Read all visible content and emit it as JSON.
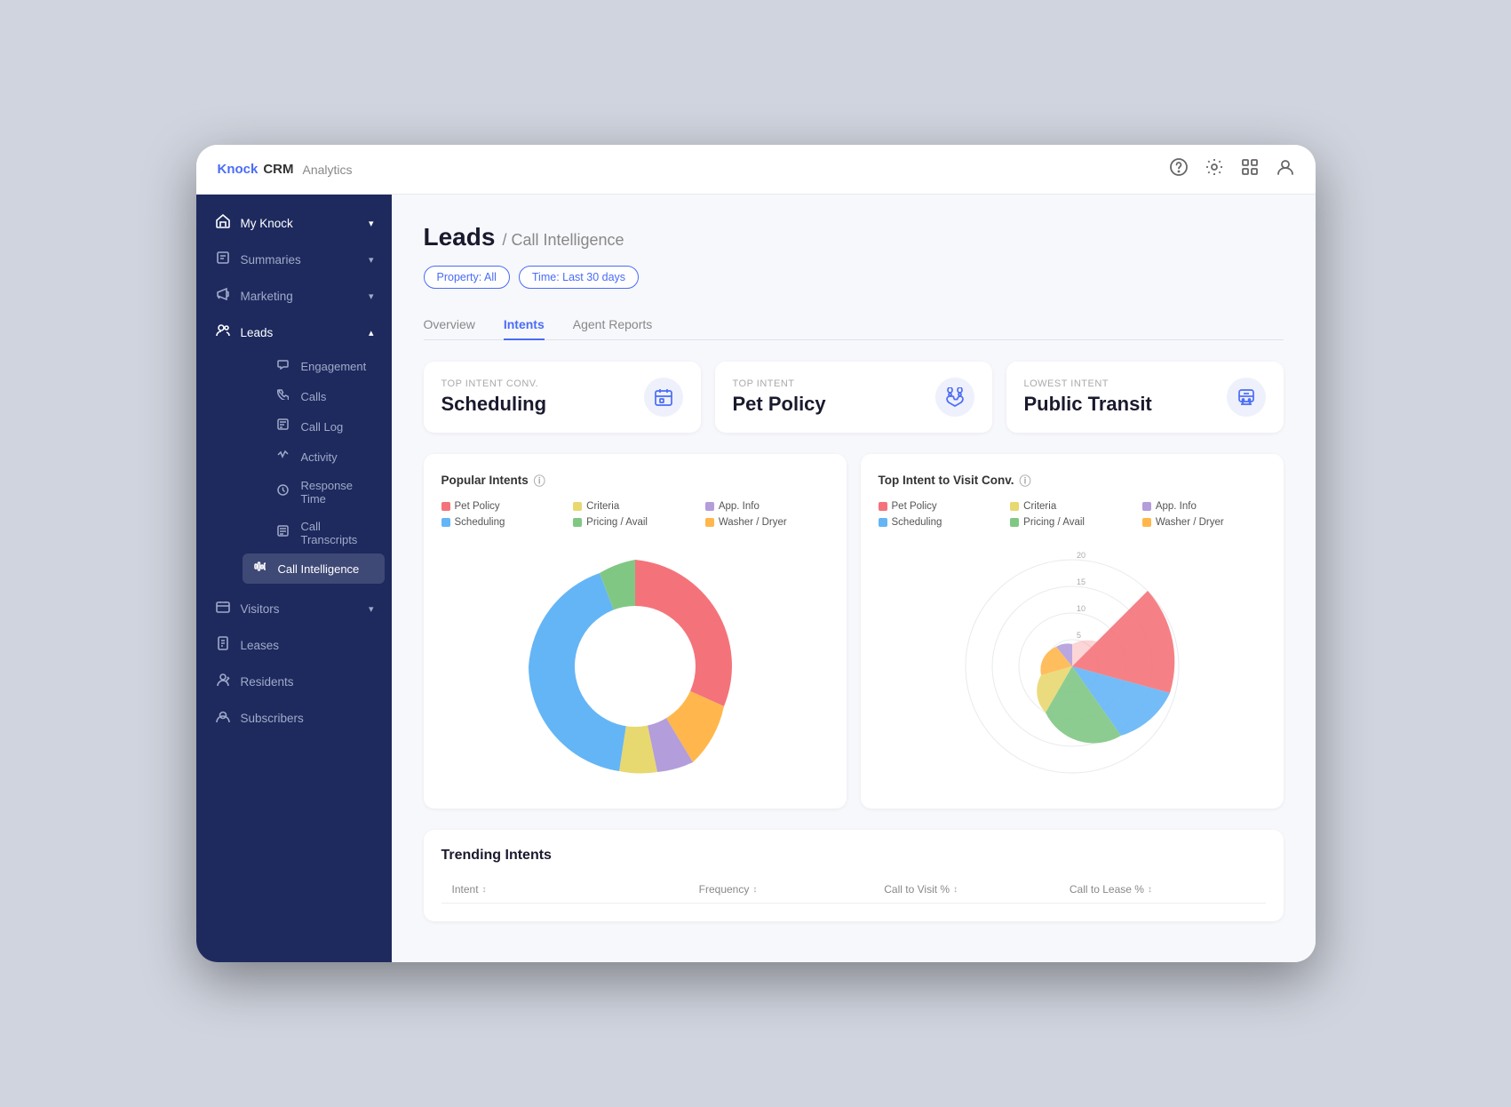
{
  "app": {
    "brand_knock": "Knock",
    "brand_crm": "CRM",
    "brand_analytics": "Analytics"
  },
  "header_icons": [
    "?",
    "⚙",
    "⊞",
    "👤"
  ],
  "sidebar": {
    "items": [
      {
        "id": "my-knock",
        "label": "My Knock",
        "icon": "🏠",
        "hasChevron": true
      },
      {
        "id": "summaries",
        "label": "Summaries",
        "icon": "📄",
        "hasChevron": true
      },
      {
        "id": "marketing",
        "label": "Marketing",
        "icon": "📢",
        "hasChevron": true
      },
      {
        "id": "leads",
        "label": "Leads",
        "icon": "👥",
        "hasChevron": true,
        "active": true
      }
    ],
    "leads_sub": [
      {
        "id": "engagement",
        "label": "Engagement",
        "icon": "💬"
      },
      {
        "id": "calls",
        "label": "Calls",
        "icon": "📞"
      },
      {
        "id": "call-log",
        "label": "Call Log",
        "icon": "📋"
      },
      {
        "id": "activity",
        "label": "Activity",
        "icon": "📊"
      },
      {
        "id": "response-time",
        "label": "Response Time",
        "icon": "⏱"
      },
      {
        "id": "call-transcripts",
        "label": "Call Transcripts",
        "icon": "📝"
      },
      {
        "id": "call-intelligence",
        "label": "Call Intelligence",
        "icon": "🎙",
        "current": true
      }
    ],
    "bottom_items": [
      {
        "id": "visitors",
        "label": "Visitors",
        "icon": "🏢",
        "hasChevron": true
      },
      {
        "id": "leases",
        "label": "Leases",
        "icon": "📑"
      },
      {
        "id": "residents",
        "label": "Residents",
        "icon": "🔑"
      },
      {
        "id": "subscribers",
        "label": "Subscribers",
        "icon": "👤"
      }
    ]
  },
  "page": {
    "title": "Leads",
    "subtitle": "/ Call Intelligence",
    "filters": [
      {
        "label": "Property: All"
      },
      {
        "label": "Time: Last 30 days"
      }
    ],
    "tabs": [
      {
        "label": "Overview",
        "active": false
      },
      {
        "label": "Intents",
        "active": true
      },
      {
        "label": "Agent Reports",
        "active": false
      }
    ]
  },
  "intent_cards": [
    {
      "label": "TOP INTENT CONV.",
      "value": "Scheduling",
      "icon": "📅"
    },
    {
      "label": "TOP INTENT",
      "value": "Pet Policy",
      "icon": "🐾"
    },
    {
      "label": "LOWEST INTENT",
      "value": "Public Transit",
      "icon": "🚌"
    }
  ],
  "popular_intents_chart": {
    "title": "Popular Intents",
    "legend": [
      {
        "label": "Pet Policy",
        "color": "#f4737a"
      },
      {
        "label": "Criteria",
        "color": "#e8d870"
      },
      {
        "label": "App. Info",
        "color": "#b39ddb"
      },
      {
        "label": "Scheduling",
        "color": "#64b5f6"
      },
      {
        "label": "Pricing / Avail",
        "color": "#81c784"
      },
      {
        "label": "Washer / Dryer",
        "color": "#ffb74d"
      }
    ],
    "segments": [
      {
        "label": "Pet Policy",
        "color": "#f4737a",
        "percent": 28,
        "startAngle": 0
      },
      {
        "label": "Washer/Dryer",
        "color": "#ffb74d",
        "percent": 8,
        "startAngle": 100
      },
      {
        "label": "App. Info",
        "color": "#b39ddb",
        "percent": 9,
        "startAngle": 129
      },
      {
        "label": "Criteria",
        "color": "#e8d870",
        "percent": 7,
        "startAngle": 161
      },
      {
        "label": "Scheduling",
        "color": "#64b5f6",
        "percent": 32,
        "startAngle": 190
      },
      {
        "label": "Pricing/Avail",
        "color": "#81c784",
        "percent": 16,
        "startAngle": 305
      }
    ]
  },
  "top_intent_chart": {
    "title": "Top Intent to Visit Conv.",
    "legend": [
      {
        "label": "Pet Policy",
        "color": "#f4737a"
      },
      {
        "label": "Criteria",
        "color": "#e8d870"
      },
      {
        "label": "App. Info",
        "color": "#b39ddb"
      },
      {
        "label": "Scheduling",
        "color": "#64b5f6"
      },
      {
        "label": "Pricing / Avail",
        "color": "#81c784"
      },
      {
        "label": "Washer / Dryer",
        "color": "#ffb74d"
      }
    ],
    "radial_labels": [
      "5",
      "10",
      "15",
      "20"
    ]
  },
  "trending": {
    "title": "Trending Intents",
    "columns": [
      {
        "label": "Intent"
      },
      {
        "label": "Frequency"
      },
      {
        "label": "Call to Visit %"
      },
      {
        "label": "Call to Lease %"
      }
    ]
  }
}
